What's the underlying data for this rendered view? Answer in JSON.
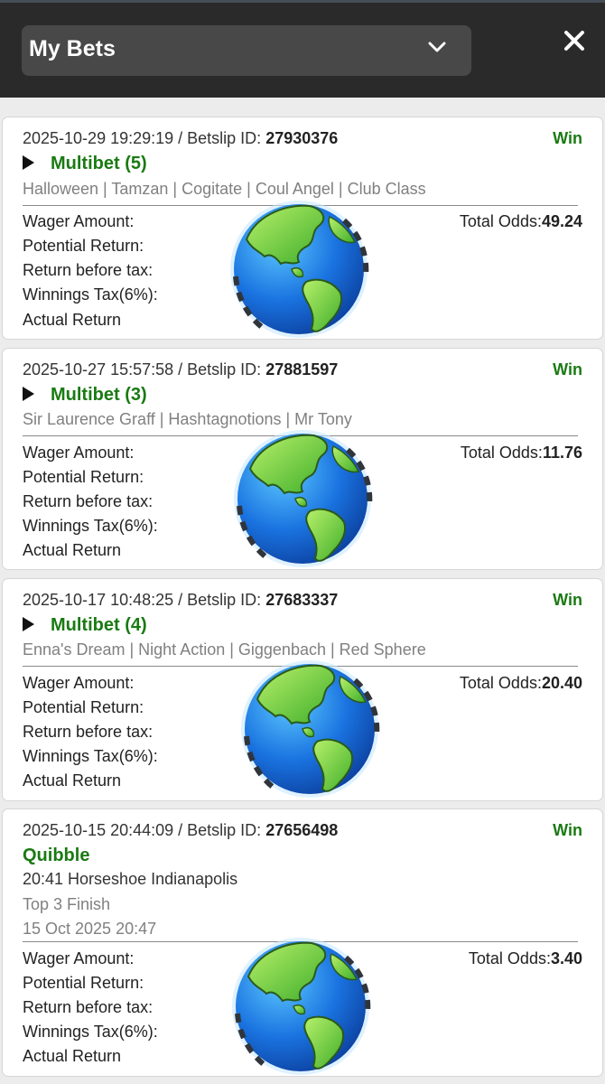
{
  "header": {
    "title": "My Bets"
  },
  "icons": {
    "dropdown": "chevron-down-icon",
    "close": "close-icon",
    "expand": "play-triangle-icon",
    "globe": "globe-icon"
  },
  "colors": {
    "win": "#1a7a13",
    "header_bg": "#2a2a2a",
    "selector_bg": "#484848"
  },
  "labels": {
    "wager": "Wager Amount:",
    "potential": "Potential Return:",
    "before_tax": "Return before tax:",
    "tax": "Winnings Tax(6%):",
    "actual": "Actual Return",
    "total_odds": "Total Odds:"
  },
  "bets": [
    {
      "datetime_prefix": "2025-10-29 19:29:19 / Betslip ID: ",
      "betslip_id": "27930376",
      "status": "Win",
      "title": "Multibet (5)",
      "selections": "Halloween | Tamzan | Cogitate | Coul Angel | Club Class",
      "total_odds": "49.24"
    },
    {
      "datetime_prefix": "2025-10-27 15:57:58 / Betslip ID: ",
      "betslip_id": "27881597",
      "status": "Win",
      "title": "Multibet (3)",
      "selections": "Sir Laurence Graff | Hashtagnotions | Mr Tony",
      "total_odds": "11.76"
    },
    {
      "datetime_prefix": "2025-10-17 10:48:25 / Betslip ID: ",
      "betslip_id": "27683337",
      "status": "Win",
      "title": "Multibet (4)",
      "selections": "Enna's Dream | Night Action | Giggenbach | Red Sphere",
      "total_odds": "20.40"
    },
    {
      "datetime_prefix": "2025-10-15 20:44:09 / Betslip ID: ",
      "betslip_id": "27656498",
      "status": "Win",
      "title": "Quibble",
      "race": "20:41 Horseshoe Indianapolis",
      "market": "Top 3 Finish",
      "placed": "15 Oct 2025 20:47",
      "total_odds": "3.40"
    }
  ]
}
